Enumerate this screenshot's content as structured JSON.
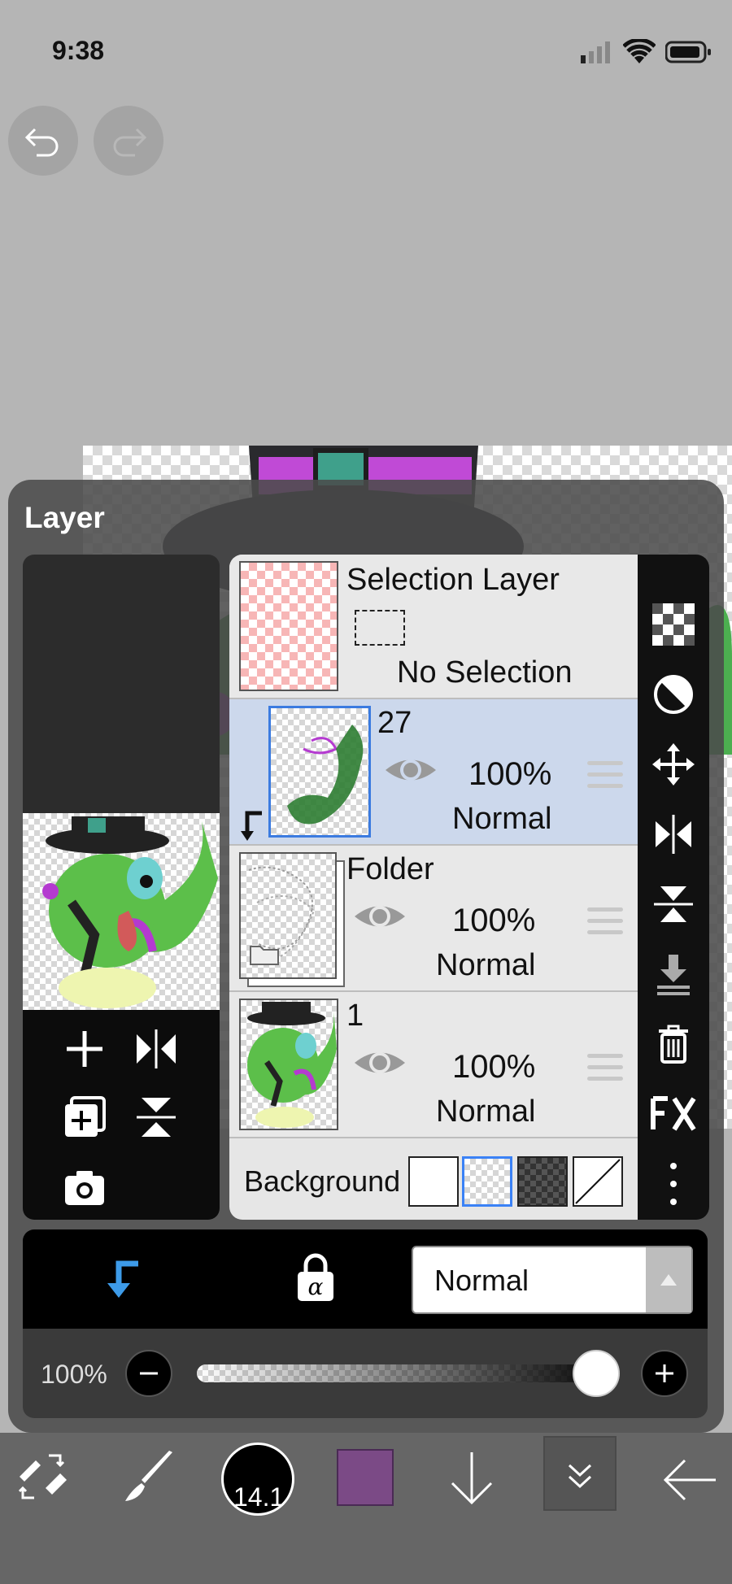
{
  "status_bar": {
    "time": "9:38"
  },
  "layer_panel": {
    "title": "Layer",
    "layers": [
      {
        "name": "Selection Layer",
        "status": "No Selection"
      },
      {
        "name": "27",
        "opacity": "100%",
        "mode": "Normal",
        "selected": true,
        "clipped": true
      },
      {
        "name": "Folder",
        "opacity": "100%",
        "mode": "Normal"
      },
      {
        "name": "1",
        "opacity": "100%",
        "mode": "Normal"
      }
    ],
    "background": {
      "label": "Background"
    },
    "blend_mode": "Normal",
    "opacity": "100%",
    "opacity_level": 1.0
  },
  "bottom_toolbar": {
    "brush_size": "14.1",
    "current_color": "#7b4a86"
  },
  "colors": {
    "selected_row": "#ccd8ec",
    "accent": "#3b82f6",
    "clip_icon": "#3d9be9"
  }
}
